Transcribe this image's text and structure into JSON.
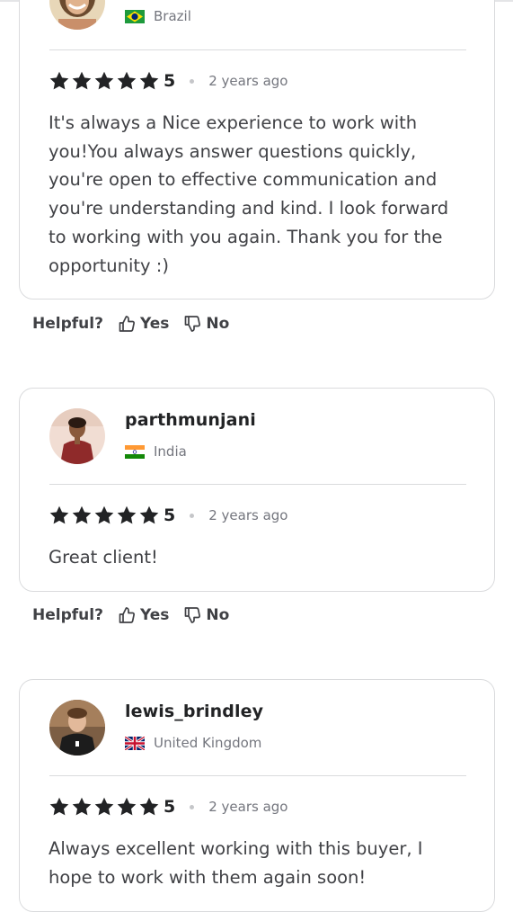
{
  "reviews": [
    {
      "username": "",
      "country": "Brazil",
      "flag": "brazil-flag",
      "rating": "5",
      "time_ago": "2 years ago",
      "text": "It's always a Nice experience to work with you!You always answer questions quickly, you're open to effective communication and you're understanding and kind. I look forward to working with you again. Thank you for the opportunity :)"
    },
    {
      "username": "parthmunjani",
      "country": "India",
      "flag": "india-flag",
      "rating": "5",
      "time_ago": "2 years ago",
      "text": "Great client!"
    },
    {
      "username": "lewis_brindley",
      "country": "United Kingdom",
      "flag": "uk-flag",
      "rating": "5",
      "time_ago": "2 years ago",
      "text": "Always excellent working with this buyer, I hope to work with them again soon!"
    }
  ],
  "helpful": {
    "label": "Helpful?",
    "yes": "Yes",
    "no": "No"
  },
  "icons": {
    "star": "star-icon",
    "thumbs_up": "thumbs-up-icon",
    "thumbs_down": "thumbs-down-icon"
  },
  "colors": {
    "star": "#222325",
    "border": "#dadbdd",
    "muted_text": "#74767e"
  }
}
